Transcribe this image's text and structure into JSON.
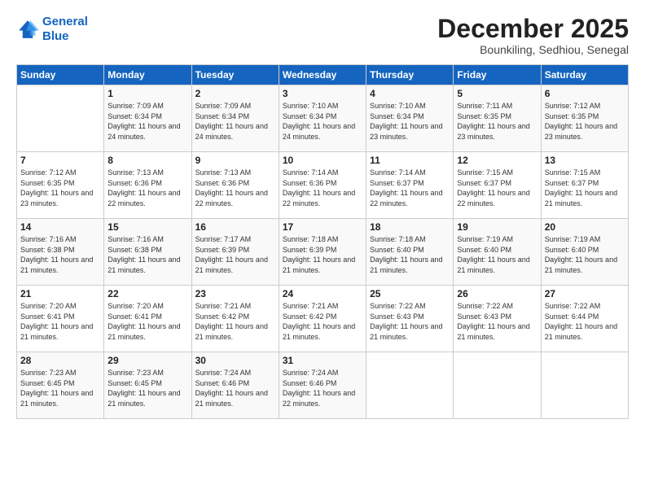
{
  "logo": {
    "line1": "General",
    "line2": "Blue"
  },
  "title": "December 2025",
  "subtitle": "Bounkiling, Sedhiou, Senegal",
  "headers": [
    "Sunday",
    "Monday",
    "Tuesday",
    "Wednesday",
    "Thursday",
    "Friday",
    "Saturday"
  ],
  "weeks": [
    [
      {
        "day": "",
        "sunrise": "",
        "sunset": "",
        "daylight": ""
      },
      {
        "day": "1",
        "sunrise": "7:09 AM",
        "sunset": "6:34 PM",
        "daylight": "11 hours and 24 minutes."
      },
      {
        "day": "2",
        "sunrise": "7:09 AM",
        "sunset": "6:34 PM",
        "daylight": "11 hours and 24 minutes."
      },
      {
        "day": "3",
        "sunrise": "7:10 AM",
        "sunset": "6:34 PM",
        "daylight": "11 hours and 24 minutes."
      },
      {
        "day": "4",
        "sunrise": "7:10 AM",
        "sunset": "6:34 PM",
        "daylight": "11 hours and 23 minutes."
      },
      {
        "day": "5",
        "sunrise": "7:11 AM",
        "sunset": "6:35 PM",
        "daylight": "11 hours and 23 minutes."
      },
      {
        "day": "6",
        "sunrise": "7:12 AM",
        "sunset": "6:35 PM",
        "daylight": "11 hours and 23 minutes."
      }
    ],
    [
      {
        "day": "7",
        "sunrise": "7:12 AM",
        "sunset": "6:35 PM",
        "daylight": "11 hours and 23 minutes."
      },
      {
        "day": "8",
        "sunrise": "7:13 AM",
        "sunset": "6:36 PM",
        "daylight": "11 hours and 22 minutes."
      },
      {
        "day": "9",
        "sunrise": "7:13 AM",
        "sunset": "6:36 PM",
        "daylight": "11 hours and 22 minutes."
      },
      {
        "day": "10",
        "sunrise": "7:14 AM",
        "sunset": "6:36 PM",
        "daylight": "11 hours and 22 minutes."
      },
      {
        "day": "11",
        "sunrise": "7:14 AM",
        "sunset": "6:37 PM",
        "daylight": "11 hours and 22 minutes."
      },
      {
        "day": "12",
        "sunrise": "7:15 AM",
        "sunset": "6:37 PM",
        "daylight": "11 hours and 22 minutes."
      },
      {
        "day": "13",
        "sunrise": "7:15 AM",
        "sunset": "6:37 PM",
        "daylight": "11 hours and 21 minutes."
      }
    ],
    [
      {
        "day": "14",
        "sunrise": "7:16 AM",
        "sunset": "6:38 PM",
        "daylight": "11 hours and 21 minutes."
      },
      {
        "day": "15",
        "sunrise": "7:16 AM",
        "sunset": "6:38 PM",
        "daylight": "11 hours and 21 minutes."
      },
      {
        "day": "16",
        "sunrise": "7:17 AM",
        "sunset": "6:39 PM",
        "daylight": "11 hours and 21 minutes."
      },
      {
        "day": "17",
        "sunrise": "7:18 AM",
        "sunset": "6:39 PM",
        "daylight": "11 hours and 21 minutes."
      },
      {
        "day": "18",
        "sunrise": "7:18 AM",
        "sunset": "6:40 PM",
        "daylight": "11 hours and 21 minutes."
      },
      {
        "day": "19",
        "sunrise": "7:19 AM",
        "sunset": "6:40 PM",
        "daylight": "11 hours and 21 minutes."
      },
      {
        "day": "20",
        "sunrise": "7:19 AM",
        "sunset": "6:40 PM",
        "daylight": "11 hours and 21 minutes."
      }
    ],
    [
      {
        "day": "21",
        "sunrise": "7:20 AM",
        "sunset": "6:41 PM",
        "daylight": "11 hours and 21 minutes."
      },
      {
        "day": "22",
        "sunrise": "7:20 AM",
        "sunset": "6:41 PM",
        "daylight": "11 hours and 21 minutes."
      },
      {
        "day": "23",
        "sunrise": "7:21 AM",
        "sunset": "6:42 PM",
        "daylight": "11 hours and 21 minutes."
      },
      {
        "day": "24",
        "sunrise": "7:21 AM",
        "sunset": "6:42 PM",
        "daylight": "11 hours and 21 minutes."
      },
      {
        "day": "25",
        "sunrise": "7:22 AM",
        "sunset": "6:43 PM",
        "daylight": "11 hours and 21 minutes."
      },
      {
        "day": "26",
        "sunrise": "7:22 AM",
        "sunset": "6:43 PM",
        "daylight": "11 hours and 21 minutes."
      },
      {
        "day": "27",
        "sunrise": "7:22 AM",
        "sunset": "6:44 PM",
        "daylight": "11 hours and 21 minutes."
      }
    ],
    [
      {
        "day": "28",
        "sunrise": "7:23 AM",
        "sunset": "6:45 PM",
        "daylight": "11 hours and 21 minutes."
      },
      {
        "day": "29",
        "sunrise": "7:23 AM",
        "sunset": "6:45 PM",
        "daylight": "11 hours and 21 minutes."
      },
      {
        "day": "30",
        "sunrise": "7:24 AM",
        "sunset": "6:46 PM",
        "daylight": "11 hours and 21 minutes."
      },
      {
        "day": "31",
        "sunrise": "7:24 AM",
        "sunset": "6:46 PM",
        "daylight": "11 hours and 22 minutes."
      },
      {
        "day": "",
        "sunrise": "",
        "sunset": "",
        "daylight": ""
      },
      {
        "day": "",
        "sunrise": "",
        "sunset": "",
        "daylight": ""
      },
      {
        "day": "",
        "sunrise": "",
        "sunset": "",
        "daylight": ""
      }
    ]
  ]
}
